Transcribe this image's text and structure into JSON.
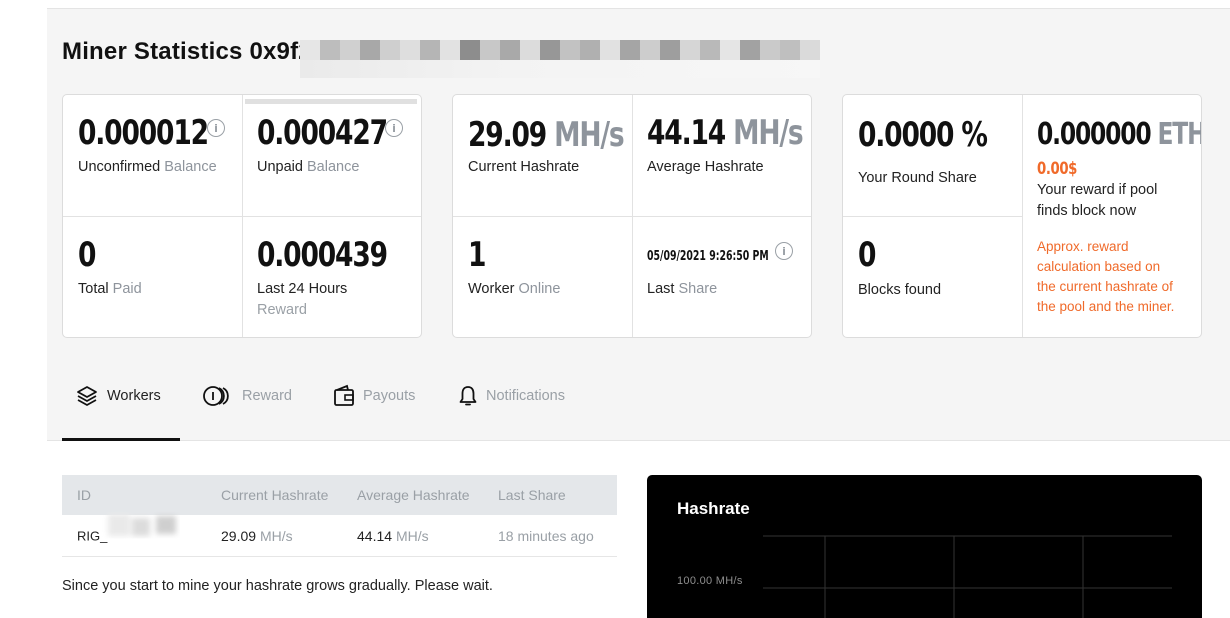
{
  "header": {
    "title": "Miner Statistics 0x9f2"
  },
  "balances": {
    "unconfirmed": {
      "value": "0.000012",
      "label": "Unconfirmed",
      "label_muted": "Balance"
    },
    "unpaid": {
      "value": "0.000427",
      "label": "Unpaid",
      "label_muted": "Balance",
      "progress": 0.0
    },
    "total_paid": {
      "value": "0",
      "label": "Total",
      "label_muted": "Paid"
    },
    "last24": {
      "value": "0.000439",
      "label": "Last 24 Hours",
      "label_muted": "Reward"
    }
  },
  "hashrate": {
    "current": {
      "value": "29.09",
      "unit": "MH/s",
      "label": "Current Hashrate"
    },
    "average": {
      "value": "44.14",
      "unit": "MH/s",
      "label": "Average Hashrate"
    },
    "workers": {
      "value": "1",
      "label": "Worker",
      "label_muted": "Online"
    },
    "last_share": {
      "value": "05/09/2021 9:26:50 PM",
      "label": "Last",
      "label_muted": "Share"
    }
  },
  "reward": {
    "round_share": {
      "value": "0.0000 %",
      "label": "Your Round Share"
    },
    "pool_reward": {
      "value": "0.000000",
      "unit": "ETH",
      "usd": "0.00$",
      "label_line1": "Your reward if pool",
      "label_line2": "finds block now"
    },
    "blocks": {
      "value": "0",
      "label": "Blocks found"
    },
    "approx_note": [
      "Approx. reward",
      "calculation based on",
      "the current hashrate of",
      "the pool and the miner."
    ]
  },
  "tabs": [
    {
      "label": "Workers",
      "active": true
    },
    {
      "label": "Reward",
      "active": false
    },
    {
      "label": "Payouts",
      "active": false
    },
    {
      "label": "Notifications",
      "active": false
    }
  ],
  "workers_table": {
    "columns": [
      "ID",
      "Current Hashrate",
      "Average Hashrate",
      "Last Share"
    ],
    "rows": [
      {
        "id": "RIG_",
        "current": "29.09",
        "current_unit": "MH/s",
        "average": "44.14",
        "average_unit": "MH/s",
        "last_share": "18 minutes ago"
      }
    ]
  },
  "note": "Since you start to mine your hashrate grows gradually. Please wait.",
  "chart": {
    "title": "Hashrate",
    "y_tick": "100.00 MH/s"
  },
  "colors": {
    "accent_orange": "#f06a2a",
    "muted": "#8e949c",
    "background": "#f5f5f5"
  }
}
